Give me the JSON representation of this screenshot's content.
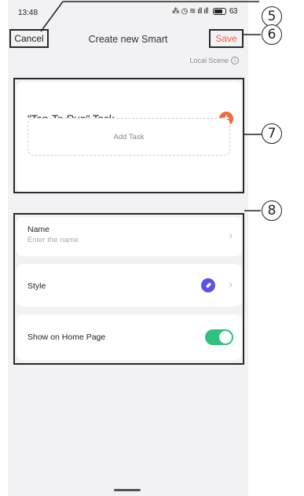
{
  "status_bar": {
    "time": "13:48",
    "indicators": " 🕒 ◐ ᴵᴵ ᴵᴵ",
    "battery": "63"
  },
  "nav": {
    "cancel_label": "Cancel",
    "title": "Create new Smart",
    "save_label": "Save"
  },
  "scene_type": {
    "label": "Local Scene",
    "info_icon": "ⓘ"
  },
  "task_section": {
    "title": "\"Tap-To-Run\" Task",
    "add_button_icon": "+",
    "add_task_label": "Add Task"
  },
  "settings": {
    "name": {
      "label": "Name",
      "placeholder": "Enter the name"
    },
    "style": {
      "label": "Style"
    },
    "show_on_home": {
      "label": "Show on Home Page",
      "enabled": true
    }
  },
  "callouts": [
    "5",
    "6",
    "7",
    "8"
  ],
  "colors": {
    "accent": "#f06040",
    "toggle_on": "#2ec27e",
    "style_icon": "#5b50e8",
    "background": "#f2f2f4"
  }
}
